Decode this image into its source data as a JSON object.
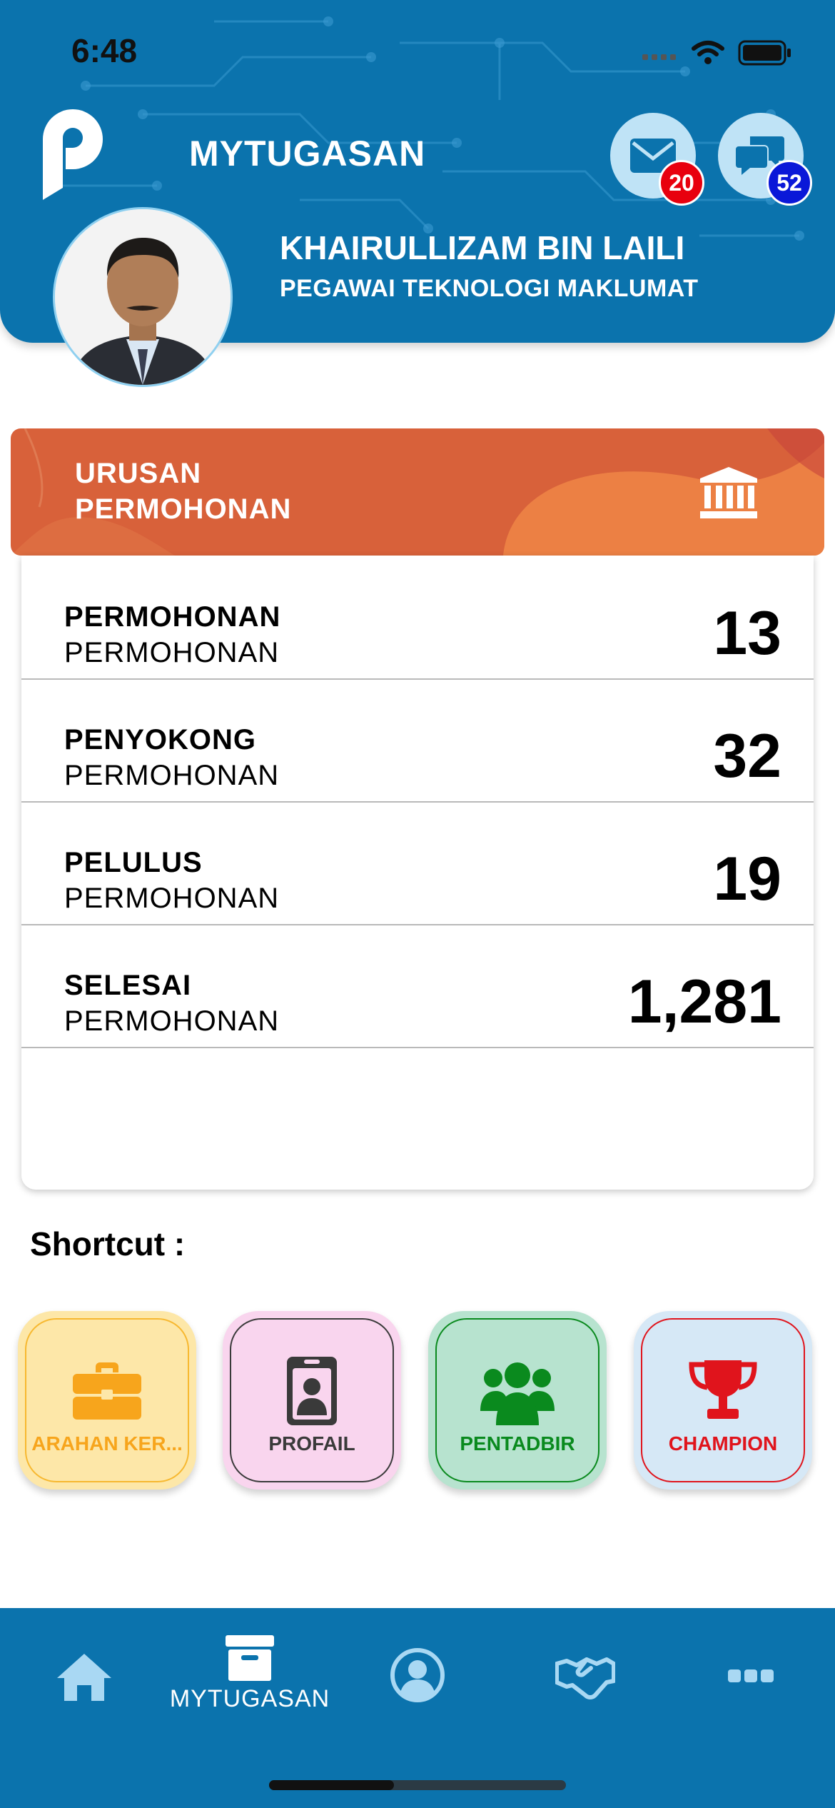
{
  "status_bar": {
    "time": "6:48"
  },
  "header": {
    "app_title": "MYTUGASAN",
    "mail_badge": "20",
    "chat_badge": "52",
    "user_name": "KHAIRULLIZAM BIN LAILI",
    "user_role": "PEGAWAI TEKNOLOGI MAKLUMAT"
  },
  "card": {
    "title_line1": "URUSAN",
    "title_line2": "PERMOHONAN",
    "rows": [
      {
        "title": "PERMOHONAN",
        "subtitle": "PERMOHONAN",
        "value": "13"
      },
      {
        "title": "PENYOKONG",
        "subtitle": "PERMOHONAN",
        "value": "32"
      },
      {
        "title": "PELULUS",
        "subtitle": "PERMOHONAN",
        "value": "19"
      },
      {
        "title": "SELESAI",
        "subtitle": "PERMOHONAN",
        "value": "1,281"
      }
    ]
  },
  "shortcut": {
    "label": "Shortcut :",
    "tiles": [
      {
        "label": "ARAHAN KER...",
        "icon": "briefcase-icon",
        "color": "#f7a51c",
        "bg": "#fde7a8"
      },
      {
        "label": "PROFAIL",
        "icon": "id-badge-icon",
        "color": "#3a3a3a",
        "bg": "#f9d5ee"
      },
      {
        "label": "PENTADBIR",
        "icon": "users-icon",
        "color": "#0a8a1e",
        "bg": "#b7e3cf"
      },
      {
        "label": "CHAMPION",
        "icon": "trophy-icon",
        "color": "#e0141c",
        "bg": "#d6e8f6"
      }
    ]
  },
  "tabbar": {
    "items": [
      {
        "icon": "home-icon",
        "label": ""
      },
      {
        "icon": "archive-icon",
        "label": "MYTUGASAN"
      },
      {
        "icon": "user-circle-icon",
        "label": ""
      },
      {
        "icon": "handshake-icon",
        "label": ""
      },
      {
        "icon": "more-icon",
        "label": ""
      }
    ]
  },
  "colors": {
    "header_blue": "#0b73ad",
    "card_orange": "#d8613a",
    "badge_red": "#e8000e",
    "badge_blue": "#0a18d8"
  }
}
